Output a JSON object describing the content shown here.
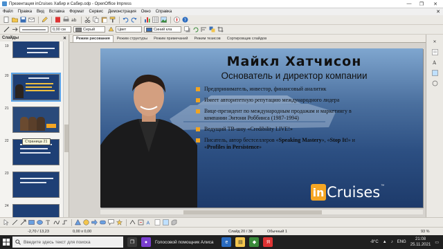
{
  "window": {
    "title": "Презентация inCruises Хабир и Сабир.odp - OpenOffice Impress",
    "minimize": "—",
    "restore": "❐",
    "close": "✕"
  },
  "menu": {
    "items": [
      "Файл",
      "Правка",
      "Вид",
      "Вставка",
      "Формат",
      "Сервис",
      "Демонстрация",
      "Окно",
      "Справка"
    ],
    "close_doc": "✕"
  },
  "toolbar2": {
    "line_width": "0,00 см",
    "line_color": "Серый",
    "area_type": "Цвет",
    "area_color": "Синий кла"
  },
  "slides_panel": {
    "title": "Слайды",
    "close": "✕",
    "slide_numbers": [
      "19",
      "20",
      "21",
      "22",
      "23",
      "24"
    ],
    "selected_number": "20",
    "tooltip": "Страница 21"
  },
  "tabs": [
    "Режим рисования",
    "Режим структуры",
    "Режим примечаний",
    "Режим тезисов",
    "Сортировщик слайдов"
  ],
  "slide": {
    "title": "Майкл Хатчисон",
    "subtitle": "Основатель и директор компании",
    "bullets": [
      {
        "text": "Предприниматель, инвестор, финансовый аналитик"
      },
      {
        "text": "Имеет авторитетную репутацию международного лидера"
      },
      {
        "text": "Вице-президент по международным продажам и маркетингу в компании Энтони Роббинса (1987-1994)"
      },
      {
        "text": "Ведущий ТВ-шоу «Credibility LIVE!»"
      },
      {
        "pre": "Писатель, автор бестселлеров «",
        "b1": "Speaking Mastery",
        "mid1": "», «",
        "b2": "Stop It!",
        "mid2": "» и «",
        "b3": "Profiles in Persistence",
        "post": "»"
      }
    ],
    "logo_mark": "in",
    "logo_text": "Cruises",
    "logo_tm": "™"
  },
  "status": {
    "position": "-2,70 / 13,23",
    "size": "0,00 x 0,00",
    "slide": "Слайд 20 / 38",
    "layout": "Обычный 1",
    "zoom": "93 %"
  },
  "taskbar": {
    "search_placeholder": "Введите здесь текст для поиска",
    "assistant": "Голосовой помощник Алиса",
    "weather": "-8°C",
    "lang": "ENG",
    "time": "21:08",
    "date": "25.11.2021"
  },
  "colors": {
    "accent": "#f0a422",
    "slide_bg": "#2c4f82",
    "logo_orange": "#f5a623"
  }
}
